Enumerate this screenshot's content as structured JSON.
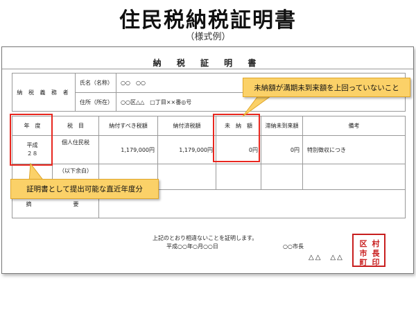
{
  "page": {
    "title": "住民税納税証明書",
    "subtitle": "（様式例）"
  },
  "document": {
    "title": "納 税 証 明 書",
    "taxpayer": {
      "label": "納 税 義 務 者",
      "name_label": "氏名（名称）",
      "name_value": "○○　○○",
      "address_label": "住所（所在）",
      "address_value": "○○区△△　□丁目××番◎号"
    },
    "table": {
      "headers": [
        "年　度",
        "税　目",
        "納付すべき税額",
        "納付済税額",
        "未　納　額",
        "滞納未到来額",
        "備考"
      ],
      "row1": {
        "year_era": "平成",
        "year_num": "２８",
        "tax_type": "個人住民税",
        "amount_due": "1,179,000円",
        "amount_paid": "1,179,000円",
        "unpaid": "0円",
        "not_yet_due": "0円",
        "remarks": "特別徴収につき"
      },
      "row2_note": "（以下余白）",
      "summary_label": "摘　　　要"
    },
    "certification": "上記のとおり相違ないことを証明します。",
    "date": "平成○○年○月○○日",
    "mayor": "○○市長",
    "signature": "△△　△△",
    "seal": {
      "chars": [
        "村",
        "区",
        "長",
        "市",
        "印",
        "町"
      ],
      "color": "#c81e1e"
    }
  },
  "callouts": {
    "unpaid": "未納額が満期未到来額を上回っていないこと",
    "year": "証明書として提出可能な直近年度分"
  },
  "colors": {
    "callout_fill": "#fbd168",
    "highlight": "#e8261e"
  }
}
